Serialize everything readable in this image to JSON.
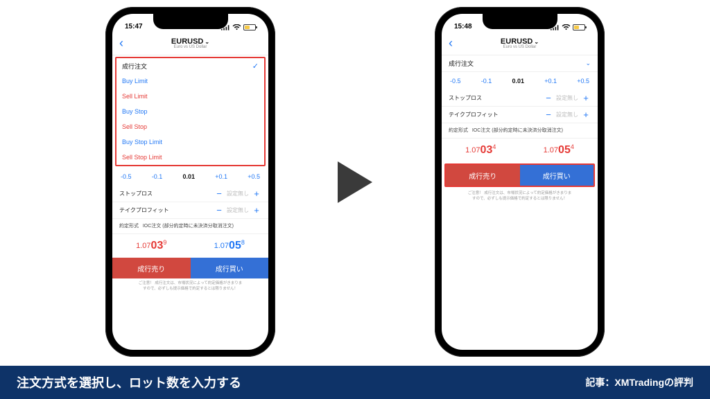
{
  "status": {
    "time_left": "15:47",
    "time_right": "15:48"
  },
  "nav": {
    "symbol": "EURUSD",
    "subtitle": "Euro vs US Dollar"
  },
  "order_types": {
    "market": "成行注文",
    "buy_limit": "Buy Limit",
    "sell_limit": "Sell Limit",
    "buy_stop": "Buy Stop",
    "sell_stop": "Sell Stop",
    "buy_stop_limit": "Buy Stop Limit",
    "sell_stop_limit": "Sell Stop Limit"
  },
  "steps": {
    "m2": "-0.5",
    "m1": "-0.1",
    "c": "0.01",
    "p1": "+0.1",
    "p2": "+0.5"
  },
  "sltp": {
    "sl_label": "ストップロス",
    "tp_label": "テイクプロフィット",
    "placeholder": "設定無し"
  },
  "fill": {
    "label": "約定形式",
    "value": "IOC注文 (部分約定時に未決済分取消注文)"
  },
  "prices_left": {
    "bid": {
      "pre": "1.07",
      "big": "03",
      "sup": "9"
    },
    "ask": {
      "pre": "1.07",
      "big": "05",
      "sup": "8"
    }
  },
  "prices_right": {
    "bid": {
      "pre": "1.07",
      "big": "03",
      "sup": "4"
    },
    "ask": {
      "pre": "1.07",
      "big": "05",
      "sup": "4"
    }
  },
  "btns": {
    "sell": "成行売り",
    "buy": "成行買い"
  },
  "note": {
    "l1": "ご注意！ 成行注文は、市場状況によって約定価格がきまりま",
    "l2": "すので、必ずしも提示価格で約定するとは限りません！"
  },
  "caption": {
    "left": "注文方式を選択し、ロット数を入力する",
    "right": "記事：XMTradingの評判"
  }
}
